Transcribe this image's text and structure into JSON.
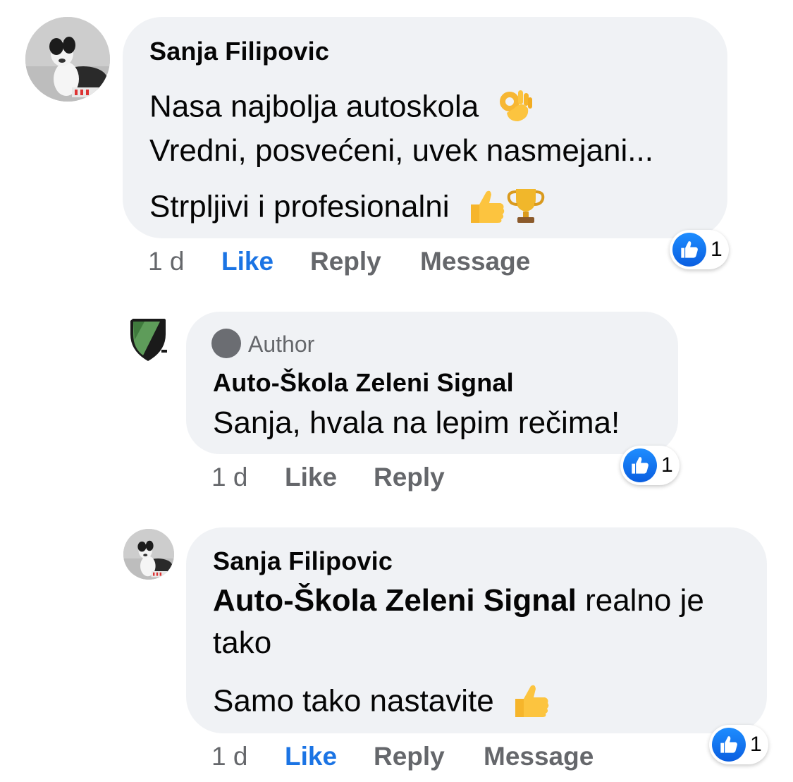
{
  "comments": [
    {
      "author": "Sanja Filipovic",
      "lines": [
        "Nasa najbolja autoskola",
        "Vredni, posvećeni, uvek nasmejani...",
        "Strpljivi i profesionalni"
      ],
      "time": "1 d",
      "like_label": "Like",
      "reply_label": "Reply",
      "message_label": "Message",
      "reaction_count": "1",
      "emojis": [
        "ok-hand-emoji",
        "thumbs-up-emoji",
        "trophy-emoji"
      ]
    },
    {
      "badge": "Author",
      "author": "Auto-Škola Zeleni Signal",
      "text": "Sanja, hvala na lepim rečima!",
      "time": "1 d",
      "like_label": "Like",
      "reply_label": "Reply",
      "reaction_count": "1"
    },
    {
      "author": "Sanja Filipovic",
      "mention": "Auto-Škola Zeleni Signal",
      "line1_rest": " realno je",
      "line2": "tako",
      "line3": "Samo tako nastavite",
      "time": "1 d",
      "like_label": "Like",
      "reply_label": "Reply",
      "message_label": "Message",
      "reaction_count": "1",
      "emojis": [
        "thumbs-up-emoji"
      ]
    }
  ],
  "colors": {
    "bubble": "#f0f2f5",
    "like_active": "#1b74e4",
    "meta": "#65676b",
    "reaction_blue": "#1877f2"
  }
}
